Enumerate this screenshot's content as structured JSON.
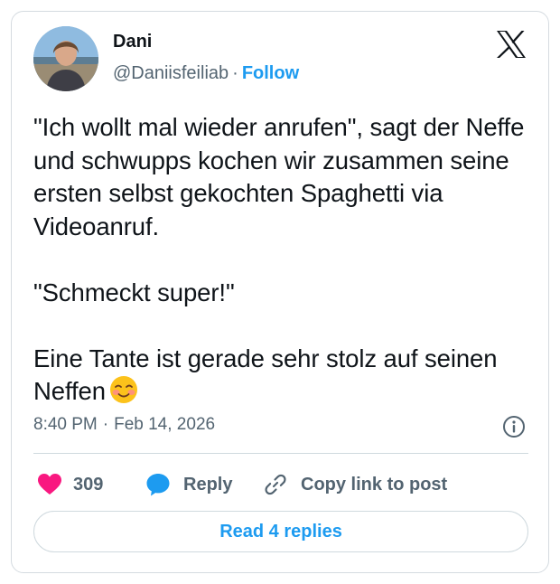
{
  "post": {
    "author_name": "Dani",
    "handle": "@Daniisfeiliab",
    "separator": "·",
    "follow_label": "Follow",
    "text": "\"Ich wollt mal wieder anrufen\", sagt der Neffe und schwupps kochen wir zusammen seine ersten selbst gekochten Spaghetti via Videoanruf.\n\n\"Schmeckt super!\"\n\nEine Tante ist gerade sehr stolz auf seinen Neffen",
    "time": "8:40 PM",
    "date": "Feb 14, 2026"
  },
  "actions": {
    "like_count": "309",
    "reply_label": "Reply",
    "copy_label": "Copy link to post"
  },
  "footer": {
    "read_replies_label": "Read 4 replies"
  },
  "icons": {
    "logo": "x-logo-icon",
    "emoji": "smiling-face-with-blush-icon",
    "info": "info-icon",
    "like": "heart-icon",
    "reply": "speech-bubble-icon",
    "copy": "link-icon"
  },
  "colors": {
    "accent": "#1d9bf0",
    "like": "#f91880",
    "text": "#0f1419",
    "secondary": "#536471"
  }
}
